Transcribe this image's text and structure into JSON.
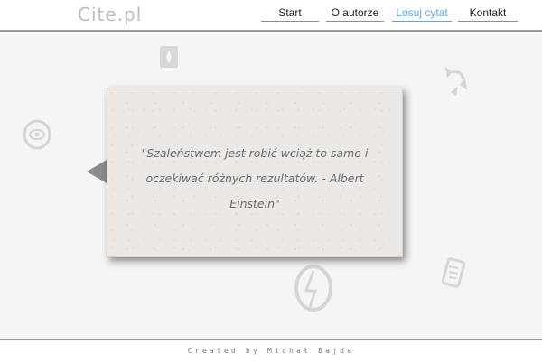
{
  "header": {
    "logo": "Cite.pl",
    "nav": [
      {
        "label": "Start",
        "active": false
      },
      {
        "label": "O autorze",
        "active": false
      },
      {
        "label": "Losuj cytat",
        "active": true
      },
      {
        "label": "Kontakt",
        "active": false
      }
    ]
  },
  "quote": {
    "text": "\"Szaleństwem jest robić wciąż to samo i oczekiwać różnych rezultatów. - Albert Einstein\""
  },
  "footer": {
    "credit": "Created by Michał Bajda"
  },
  "colors": {
    "accent": "#5aa9d8",
    "card": "#ebe8e5",
    "border": "#9a9a9a"
  },
  "decorations": [
    "compass-icon",
    "recycle-icon",
    "eye-icon",
    "globe-icon",
    "scroll-icon"
  ]
}
